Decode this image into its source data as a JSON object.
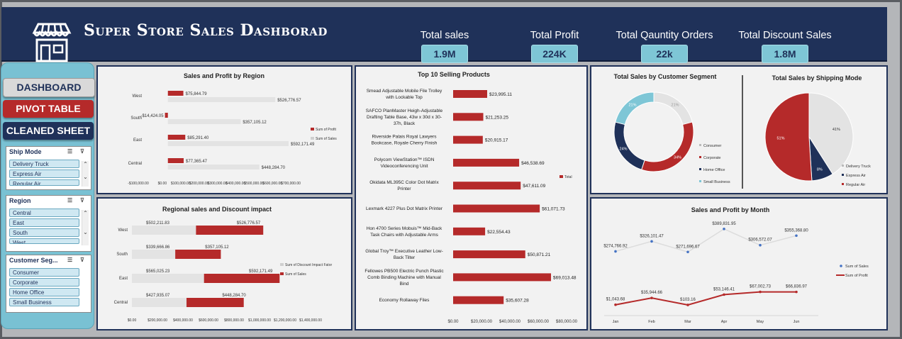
{
  "header": {
    "title": "Super Store Sales Dashborad",
    "kpis": [
      {
        "label": "Total sales",
        "value": "1.9M"
      },
      {
        "label": "Total Profit",
        "value": "224K"
      },
      {
        "label": "Total Qauntity Orders",
        "value": "22k"
      },
      {
        "label": "Total Discount Sales",
        "value": "1.8M"
      }
    ]
  },
  "nav": {
    "dashboard": "DASHBOARD",
    "pivot": "PIVOT TABLE",
    "cleaned": "CLEANED SHEET"
  },
  "slicers": {
    "ship": {
      "title": "Ship Mode",
      "items": [
        "Delivery Truck",
        "Express Air",
        "Regular Air"
      ]
    },
    "region": {
      "title": "Region",
      "items": [
        "Central",
        "East",
        "South",
        "West"
      ]
    },
    "segment": {
      "title": "Customer Seg...",
      "items": [
        "Consumer",
        "Corporate",
        "Home Office",
        "Small Business"
      ]
    }
  },
  "colors": {
    "profit": "#b52a2a",
    "sales": "#e3e3e3",
    "navy": "#1f3159",
    "teal": "#7ec6d6"
  },
  "chart_data": [
    {
      "id": "region",
      "type": "bar",
      "title": "Sales and Profit by Region",
      "categories": [
        "West",
        "South",
        "East",
        "Central"
      ],
      "series": [
        {
          "name": "Sum of Profit",
          "values": [
            75844.79,
            -14424.05,
            85291.4,
            77365.47
          ],
          "labels": [
            "$75,844.79",
            "-$14,424.05",
            "$85,291.40",
            "$77,365.47"
          ]
        },
        {
          "name": "Sum of Sales",
          "values": [
            526776.57,
            357105.12,
            592171.49,
            448284.7
          ],
          "labels": [
            "$526,776.57",
            "$357,105.12",
            "$592,171.49",
            "$448,284.70"
          ]
        }
      ],
      "xticks": [
        "-$100,000.00",
        "$0.00",
        "$100,000.00",
        "$200,000.00",
        "$300,000.00",
        "$400,000.00",
        "$500,000.00",
        "$600,000.00",
        "$700,000.00"
      ],
      "xlim": [
        -100000,
        700000
      ]
    },
    {
      "id": "discount",
      "type": "bar",
      "title": "Regional sales and Discount impact",
      "categories": [
        "West",
        "South",
        "East",
        "Central"
      ],
      "series": [
        {
          "name": "Sum of Discount Impact Fator",
          "values": [
            502211.83,
            339666.86,
            565025.23,
            427935.07
          ],
          "labels": [
            "$502,211.83",
            "$339,666.86",
            "$565,025.23",
            "$427,935.07"
          ]
        },
        {
          "name": "Sum of Sales",
          "values": [
            526776.57,
            357105.12,
            592171.49,
            448284.7
          ],
          "labels": [
            "$526,776.57",
            "$357,105.12",
            "$592,171.49",
            "$448,284.70"
          ]
        }
      ],
      "xticks": [
        "$0.00",
        "$200,000.00",
        "$400,000.00",
        "$600,000.00",
        "$800,000.00",
        "$1,000,000.00",
        "$1,200,000.00",
        "$1,400,000.00"
      ],
      "xlim": [
        0,
        1400000
      ]
    },
    {
      "id": "top10",
      "type": "bar",
      "title": "Top 10 Selling Products",
      "legend": "Total",
      "categories": [
        [
          "Smead Adjustable Mobile File Trolley",
          "with Lockable Top"
        ],
        [
          "SAFCO PlanMaster Heigh-Adjustable",
          "Drafting Table Base, 43w x 30d x 30-",
          "37h, Black"
        ],
        [
          "Riverside Palais Royal Lawyers",
          "Bookcase, Royale Cherry Finish"
        ],
        [
          "Polycom ViewStation™ ISDN",
          "Videoconferencing Unit"
        ],
        [
          "Okidata ML395C Color Dot Matrix",
          "Printer"
        ],
        [
          "Lexmark 4227 Plus Dot Matrix Printer"
        ],
        [
          "Hon 4700 Series Mobuis™ Mid-Back",
          "Task Chairs with Adjustable Arms"
        ],
        [
          "Global Troy™ Executive Leather Low-",
          "Back Tilter"
        ],
        [
          "Fellowes PB500 Electric Punch Plastic",
          "Comb Binding Machine with Manual",
          "Bind"
        ],
        [
          "Economy Rollaway Files"
        ]
      ],
      "values": [
        23995.11,
        21253.25,
        20915.17,
        46538.69,
        47611.09,
        61071.73,
        22554.43,
        50871.21,
        69013.48,
        35607.28
      ],
      "labels": [
        "$23,995.11",
        "$21,253.25",
        "$20,915.17",
        "$46,538.69",
        "$47,611.09",
        "$61,071.73",
        "$22,554.43",
        "$50,871.21",
        "$69,013.48",
        "$35,607.28"
      ],
      "xticks": [
        "$0.00",
        "$20,000.00",
        "$40,000.00",
        "$60,000.00",
        "$80,000.00"
      ],
      "xlim": [
        0,
        80000
      ]
    },
    {
      "id": "segment",
      "type": "pie",
      "title": "Total Sales by Customer Segment",
      "labels": [
        "Consumer",
        "Corporate",
        "Home Office",
        "Small Business"
      ],
      "values": [
        21,
        34,
        24,
        21
      ],
      "pct": [
        "21%",
        "34%",
        "24%",
        "21%"
      ],
      "colors": [
        "#e3e3e3",
        "#b52a2a",
        "#1f3159",
        "#7ec6d6"
      ]
    },
    {
      "id": "shipping",
      "type": "pie",
      "title": "Total Sales by Shipping Mode",
      "labels": [
        "Delivery Truck",
        "Express Air",
        "Regular Air"
      ],
      "values": [
        41,
        8,
        51
      ],
      "pct": [
        "41%",
        "8%",
        "51%"
      ],
      "colors": [
        "#e3e3e3",
        "#1f3159",
        "#b52a2a"
      ]
    },
    {
      "id": "month",
      "type": "line",
      "title": "Sales and Profit by Month",
      "categories": [
        "Jan",
        "Feb",
        "Mar",
        "Apr",
        "May",
        "Jun"
      ],
      "series": [
        {
          "name": "Sum of Sales",
          "values": [
            274766.92,
            326101.47,
            271696.67,
            389831.95,
            306572.07,
            355368.8
          ],
          "labels": [
            "$274,766.92",
            "$326,101.47",
            "$271,696.67",
            "$389,831.95",
            "$306,572.07",
            "$355,368.80"
          ]
        },
        {
          "name": "Sum of Profit",
          "values": [
            1043.68,
            35944.66,
            103.16,
            53146.41,
            67002.73,
            66836.97
          ],
          "labels": [
            "$1,043.68",
            "$35,944.66",
            "$103.16",
            "$53,146.41",
            "$67,002.73",
            "$66,836.97"
          ]
        }
      ]
    }
  ]
}
